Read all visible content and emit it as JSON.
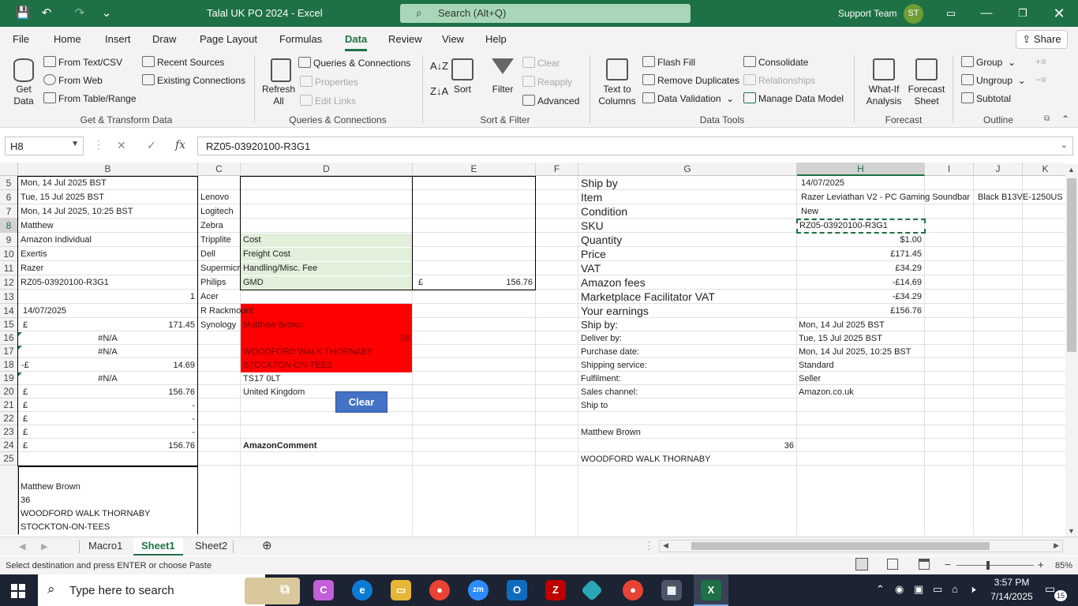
{
  "title": {
    "text": "Talal UK PO 2024 - Excel",
    "search_placeholder": "Search (Alt+Q)",
    "user": "Support Team",
    "avatar": "ST"
  },
  "menu": {
    "tabs": [
      "File",
      "Home",
      "Insert",
      "Draw",
      "Page Layout",
      "Formulas",
      "Data",
      "Review",
      "View",
      "Help"
    ],
    "active": "Data",
    "share": "Share"
  },
  "ribbon": {
    "get_data": "Get\nData",
    "from_text_csv": "From Text/CSV",
    "from_web": "From Web",
    "from_table": "From Table/Range",
    "recent_sources": "Recent Sources",
    "existing_connections": "Existing Connections",
    "refresh_all": "Refresh\nAll",
    "queries_connections": "Queries & Connections",
    "properties": "Properties",
    "edit_links": "Edit Links",
    "sort": "Sort",
    "filter": "Filter",
    "clear": "Clear",
    "reapply": "Reapply",
    "advanced": "Advanced",
    "text_to_columns": "Text to\nColumns",
    "flash_fill": "Flash Fill",
    "remove_duplicates": "Remove Duplicates",
    "data_validation": "Data Validation",
    "consolidate": "Consolidate",
    "relationships": "Relationships",
    "manage_data_model": "Manage Data Model",
    "what_if": "What-If\nAnalysis",
    "forecast_sheet": "Forecast\nSheet",
    "group": "Group",
    "ungroup": "Ungroup",
    "subtotal": "Subtotal",
    "groups": {
      "get_transform": "Get & Transform Data",
      "queries": "Queries & Connections",
      "sort_filter": "Sort & Filter",
      "data_tools": "Data Tools",
      "forecast": "Forecast",
      "outline": "Outline"
    }
  },
  "formula_bar": {
    "name_box": "H8",
    "formula": "RZ05-03920100-R3G1"
  },
  "grid": {
    "columns": [
      "B",
      "C",
      "D",
      "E",
      "F",
      "G",
      "H",
      "I",
      "J",
      "K"
    ],
    "rows": [
      "5",
      "6",
      "7",
      "8",
      "9",
      "10",
      "11",
      "12",
      "13",
      "14",
      "15",
      "16",
      "17",
      "18",
      "19",
      "20",
      "21",
      "22",
      "23",
      "24",
      "25"
    ],
    "col_b": [
      "Mon, 14 Jul 2025 BST",
      "Tue, 15 Jul 2025 BST",
      "Mon, 14 Jul 2025, 10:25 BST",
      "Matthew",
      "Amazon Individual",
      "Exertis",
      "Razer",
      "RZ05-03920100-R3G1",
      "1",
      "14/07/2025",
      "£",
      "171.45",
      "#N/A",
      "#N/A",
      "-£",
      "14.69",
      "#N/A",
      "£",
      "156.76",
      "£",
      "-",
      "£",
      "-",
      "£",
      "-",
      "£",
      "156.76"
    ],
    "col_b_address": [
      "Matthew Brown",
      "36",
      "WOODFORD WALK THORNABY",
      "STOCKTON-ON-TEES"
    ],
    "col_c": [
      "Lenovo",
      "Logitech",
      "Zebra",
      "Tripplite",
      "Dell",
      "Supermicro",
      "Philips",
      "Acer",
      "R Rackmount",
      "Synology"
    ],
    "col_d": {
      "cost": "Cost",
      "freight": "Freight Cost",
      "handling": "Handling/Misc. Fee",
      "gmd": "GMD",
      "red_name": "Matthew Brown",
      "red_num": "36",
      "red_addr1": "WOODFORD WALK THORNABY",
      "red_addr2": "STOCKTON-ON-TEES",
      "postcode": "TS17 0LT",
      "country": "United Kingdom",
      "amazon_comment": "AmazonComment"
    },
    "col_e": {
      "gmd_currency": "£",
      "gmd_value": "156.76"
    },
    "col_g": [
      "Ship by",
      "Item",
      "Condition",
      "SKU",
      "Quantity",
      "Price",
      "VAT",
      "Amazon fees",
      "Marketplace Facilitator VAT",
      "Your earnings",
      "Ship by:",
      "Deliver by:",
      "Purchase date:",
      "Shipping service:",
      "Fulfilment:",
      "Sales channel:",
      "Ship to",
      "",
      "Matthew Brown",
      "WOODFORD WALK THORNABY"
    ],
    "g24_num": "36",
    "col_h": [
      "14/07/2025",
      "Razer Leviathan V2 - PC Gaming Soundbar",
      "New",
      "RZ05-03920100-R3G1",
      "$1.00",
      "£171.45",
      "£34.29",
      "-£14.69",
      "-£34.29",
      "£156.76",
      "Mon, 14 Jul 2025 BST",
      "Tue, 15 Jul 2025 BST",
      "Mon, 14 Jul 2025, 10:25 BST",
      "Standard",
      "Seller",
      "Amazon.co.uk"
    ],
    "i6": "Black B13VE-1250US"
  },
  "clear_button": "Clear",
  "sheets": {
    "tabs": [
      "Macro1",
      "Sheet1",
      "Sheet2"
    ],
    "active": "Sheet1"
  },
  "status": {
    "message": "Select destination and press ENTER or choose Paste",
    "zoom": "85%"
  },
  "taskbar": {
    "search_placeholder": "Type here to search",
    "time": "3:57 PM",
    "date": "7/14/2025",
    "notifications": "15"
  },
  "colors": {
    "excel_green": "#1e7145",
    "red_fill": "#ff0000",
    "green_fill": "#e2efda",
    "button_blue": "#4472c4"
  }
}
